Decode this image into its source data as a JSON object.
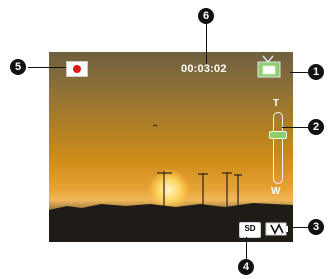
{
  "hud": {
    "timer": "00:03:02"
  },
  "zoom": {
    "tele_label": "T",
    "wide_label": "W",
    "level": 0.25
  },
  "storage": {
    "card_label": "SD"
  },
  "callouts": [
    "1",
    "2",
    "3",
    "4",
    "5",
    "6"
  ],
  "icons": {
    "record_mode": "record-icon",
    "scene_mode": "scene-mode-icon",
    "battery": "battery-icon",
    "storage": "sd-card-icon"
  },
  "colors": {
    "record_dot": "#e01818",
    "zoom_knob": "#8fcf69",
    "scene_icon": "#8fcf69"
  }
}
